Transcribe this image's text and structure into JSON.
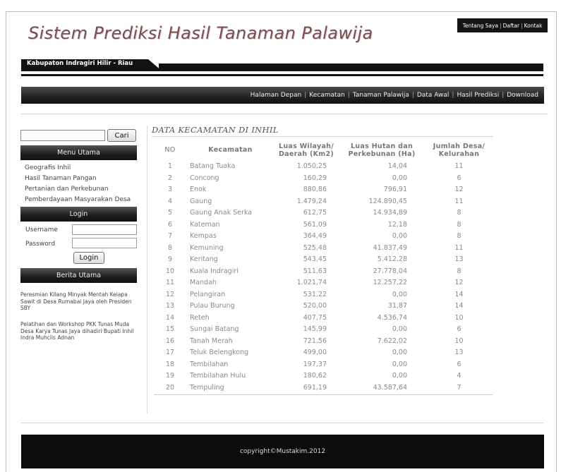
{
  "header": {
    "top_links": [
      "Tentang Saya",
      "Daftar",
      "Kontak"
    ],
    "site_title": "Sistem Prediksi Hasil Tanaman Palawija",
    "subtitle": "Kabupaton Indragiri Hilir - Riau"
  },
  "nav": {
    "items": [
      "Halaman Depan",
      "Kecamatan",
      "Tanaman Palawija",
      "Data Awal",
      "Hasil Prediksi",
      "Download"
    ]
  },
  "sidebar": {
    "search": {
      "value": "",
      "button": "Cari"
    },
    "menu_title": "Menu Utama",
    "menu_items": [
      "Geografis Inhil",
      "Hasil Tanaman Pangan",
      "Pertanian dan Perkebunan",
      "Pemberdayaan Masyarakan Desa"
    ],
    "login_title": "Login",
    "username_label": "Username",
    "password_label": "Password",
    "login_button": "Login",
    "news_title": "Berita Utama",
    "news": [
      "Peresmian Kilang Minyak Mentah Kelapa Sawit di Desa Rumabai Jaya oleh Presiden SBY",
      "Pelatihan dan Workshop PKK Tunas Muda Desa Karya Tunas Jaya dihadiri Bupati Inhil Indra Muhclis Adnan"
    ]
  },
  "content": {
    "title": "DATA KECAMATAN DI INHIL",
    "columns": {
      "no": "NO",
      "kecamatan": "Kecamatan",
      "luas_line1": "Luas Wilayah/",
      "luas_line2": "Daerah (Km2)",
      "hutan_line1": "Luas Hutan dan",
      "hutan_line2": "Perkebunan (Ha)",
      "desa_line1": "Jumlah Desa/",
      "desa_line2": "Kelurahan"
    },
    "rows": [
      [
        "1",
        "Batang Tuaka",
        "1.050,25",
        "14,04",
        "11"
      ],
      [
        "2",
        "Concong",
        "160,29",
        "0,00",
        "6"
      ],
      [
        "3",
        "Enok",
        "880,86",
        "796,91",
        "12"
      ],
      [
        "4",
        "Gaung",
        "1.479,24",
        "124.890,45",
        "11"
      ],
      [
        "5",
        "Gaung Anak Serka",
        "612,75",
        "14.934,89",
        "8"
      ],
      [
        "6",
        "Kateman",
        "561,09",
        "12,18",
        "8"
      ],
      [
        "7",
        "Kempas",
        "364,49",
        "0,00",
        "8"
      ],
      [
        "8",
        "Kemuning",
        "525,48",
        "41.837,49",
        "11"
      ],
      [
        "9",
        "Keritang",
        "543,45",
        "5.412,28",
        "13"
      ],
      [
        "10",
        "Kuala Indragiri",
        "511,63",
        "27.778,04",
        "8"
      ],
      [
        "11",
        "Mandah",
        "1.021,74",
        "12.257,22",
        "12"
      ],
      [
        "12",
        "Pelangiran",
        "531,22",
        "0,00",
        "14"
      ],
      [
        "13",
        "Pulau Burung",
        "520,00",
        "31,87",
        "14"
      ],
      [
        "14",
        "Reteh",
        "407,75",
        "4.536,74",
        "10"
      ],
      [
        "15",
        "Sungai Batang",
        "145,99",
        "0,00",
        "6"
      ],
      [
        "16",
        "Tanah Merah",
        "721,56",
        "7.622,02",
        "10"
      ],
      [
        "17",
        "Teluk Belengkong",
        "499,00",
        "0,00",
        "13"
      ],
      [
        "18",
        "Tembilahan",
        "197,37",
        "0,00",
        "6"
      ],
      [
        "19",
        "Tembilahan Hulu",
        "180,62",
        "0,00",
        "4"
      ],
      [
        "20",
        "Tempuling",
        "691,19",
        "43.587,64",
        "7"
      ]
    ]
  },
  "footer": {
    "text": "copyright©Mustakim.2012"
  },
  "colors": {
    "title": "#7a4d52",
    "bar": "#121212",
    "text": "#8a8a8a"
  }
}
